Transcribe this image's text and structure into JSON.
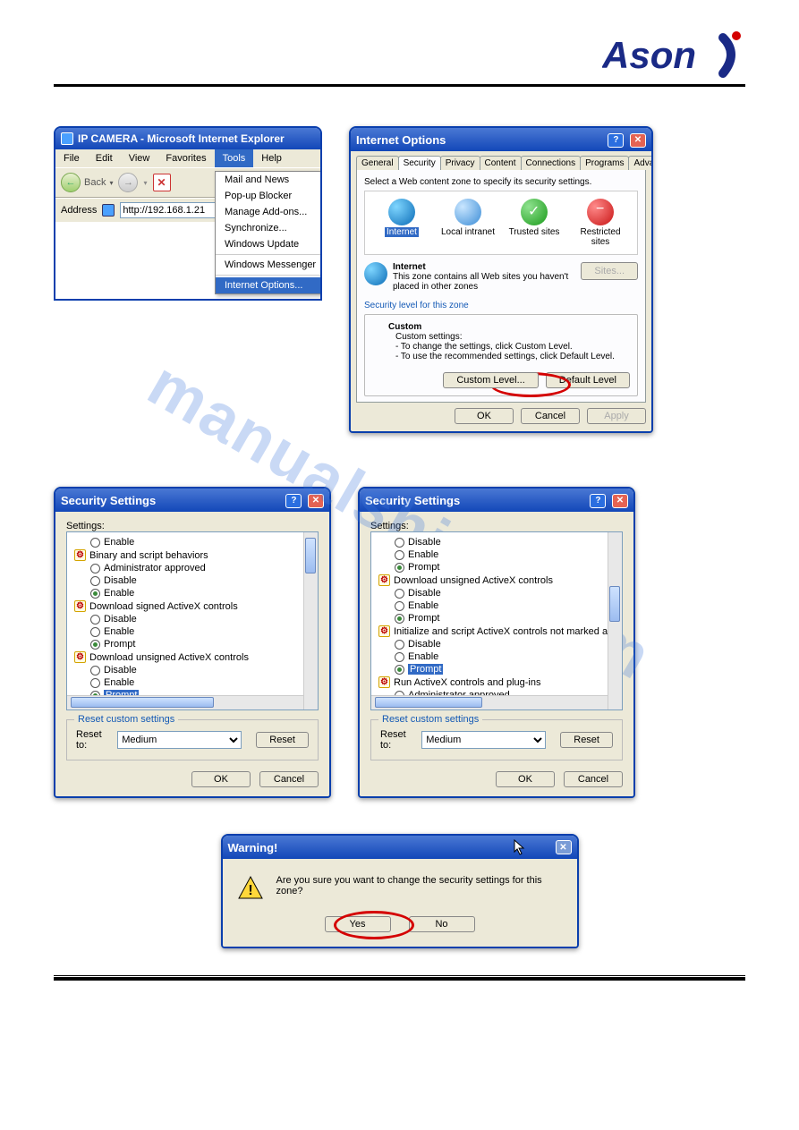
{
  "logo_text": "Asoni",
  "watermark": "manualshive.com",
  "ie": {
    "title": "IP CAMERA - Microsoft Internet Explorer",
    "menu": [
      "File",
      "Edit",
      "View",
      "Favorites",
      "Tools",
      "Help"
    ],
    "active_menu": "Tools",
    "back": "Back",
    "address_label": "Address",
    "address_value": "http://192.168.1.21",
    "dropdown": {
      "items": [
        {
          "label": "Mail and News",
          "arrow": true
        },
        {
          "label": "Pop-up Blocker",
          "arrow": true
        },
        {
          "label": "Manage Add-ons..."
        },
        {
          "label": "Synchronize..."
        },
        {
          "label": "Windows Update"
        }
      ],
      "sep1": true,
      "items2": [
        {
          "label": "Windows Messenger"
        }
      ],
      "sep2": true,
      "items3": [
        {
          "label": "Internet Options...",
          "selected": true
        }
      ]
    }
  },
  "io": {
    "title": "Internet Options",
    "tabs": [
      "General",
      "Security",
      "Privacy",
      "Content",
      "Connections",
      "Programs",
      "Advanced"
    ],
    "active_tab": "Security",
    "zone_instr": "Select a Web content zone to specify its security settings.",
    "zones": [
      {
        "name": "Internet",
        "sel": true
      },
      {
        "name": "Local intranet"
      },
      {
        "name": "Trusted sites"
      },
      {
        "name": "Restricted sites"
      }
    ],
    "zone_head": "Internet",
    "zone_desc": "This zone contains all Web sites you haven't placed in other zones",
    "sites_btn": "Sites...",
    "sec_level_label": "Security level for this zone",
    "custom_head": "Custom",
    "custom_l1": "Custom settings:",
    "custom_l2": "- To change the settings, click Custom Level.",
    "custom_l3": "- To use the recommended settings, click Default Level.",
    "custom_level_btn": "Custom Level...",
    "default_level_btn": "Default Level",
    "ok": "OK",
    "cancel": "Cancel",
    "apply": "Apply"
  },
  "ss_left": {
    "title": "Security Settings",
    "settings_label": "Settings:",
    "items": [
      {
        "t": "radio",
        "lvl": 2,
        "label": "Enable"
      },
      {
        "t": "cat",
        "lvl": 1,
        "label": "Binary and script behaviors"
      },
      {
        "t": "radio",
        "lvl": 2,
        "label": "Administrator approved"
      },
      {
        "t": "radio",
        "lvl": 2,
        "label": "Disable"
      },
      {
        "t": "radio",
        "lvl": 2,
        "label": "Enable",
        "sel": true
      },
      {
        "t": "cat",
        "lvl": 1,
        "label": "Download signed ActiveX controls"
      },
      {
        "t": "radio",
        "lvl": 2,
        "label": "Disable"
      },
      {
        "t": "radio",
        "lvl": 2,
        "label": "Enable"
      },
      {
        "t": "radio",
        "lvl": 2,
        "label": "Prompt",
        "sel": true
      },
      {
        "t": "cat",
        "lvl": 1,
        "label": "Download unsigned ActiveX controls"
      },
      {
        "t": "radio",
        "lvl": 2,
        "label": "Disable"
      },
      {
        "t": "radio",
        "lvl": 2,
        "label": "Enable"
      },
      {
        "t": "radio",
        "lvl": 2,
        "label": "Prompt",
        "sel": true,
        "hl": true
      }
    ],
    "reset_group": "Reset custom settings",
    "reset_to": "Reset to:",
    "reset_value": "Medium",
    "reset_btn": "Reset",
    "ok": "OK",
    "cancel": "Cancel"
  },
  "ss_right": {
    "title": "Security Settings",
    "settings_label": "Settings:",
    "items": [
      {
        "t": "radio",
        "lvl": 2,
        "label": "Disable"
      },
      {
        "t": "radio",
        "lvl": 2,
        "label": "Enable"
      },
      {
        "t": "radio",
        "lvl": 2,
        "label": "Prompt",
        "sel": true
      },
      {
        "t": "cat",
        "lvl": 1,
        "label": "Download unsigned ActiveX controls"
      },
      {
        "t": "radio",
        "lvl": 2,
        "label": "Disable"
      },
      {
        "t": "radio",
        "lvl": 2,
        "label": "Enable"
      },
      {
        "t": "radio",
        "lvl": 2,
        "label": "Prompt",
        "sel": true
      },
      {
        "t": "cat",
        "lvl": 1,
        "label": "Initialize and script ActiveX controls not marked as safe"
      },
      {
        "t": "radio",
        "lvl": 2,
        "label": "Disable"
      },
      {
        "t": "radio",
        "lvl": 2,
        "label": "Enable"
      },
      {
        "t": "radio",
        "lvl": 2,
        "label": "Prompt",
        "sel": true,
        "hl": true
      },
      {
        "t": "cat",
        "lvl": 1,
        "label": "Run ActiveX controls and plug-ins"
      },
      {
        "t": "radio",
        "lvl": 2,
        "label": "Administrator approved"
      }
    ],
    "reset_group": "Reset custom settings",
    "reset_to": "Reset to:",
    "reset_value": "Medium",
    "reset_btn": "Reset",
    "ok": "OK",
    "cancel": "Cancel"
  },
  "warn": {
    "title": "Warning!",
    "msg": "Are you sure you want to change the security settings for this zone?",
    "yes": "Yes",
    "no": "No"
  }
}
